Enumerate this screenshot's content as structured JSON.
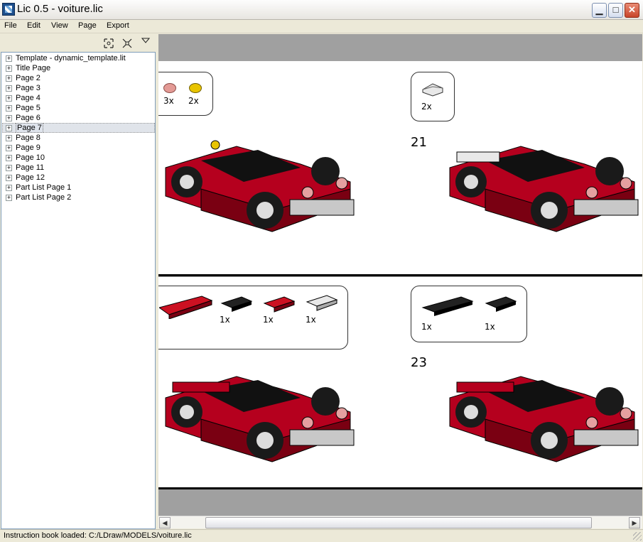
{
  "window": {
    "title": "Lic 0.5 - voiture.lic",
    "minimize_glyph": "▁",
    "maximize_glyph": "□",
    "close_glyph": "✕"
  },
  "menu": {
    "items": [
      "File",
      "Edit",
      "View",
      "Page",
      "Export"
    ]
  },
  "toolbar": {
    "icons": [
      "zoom-extents-icon",
      "zoom-fit-icon",
      "dropdown-arrow-icon"
    ]
  },
  "tree": {
    "items": [
      "Template - dynamic_template.lit",
      "Title Page",
      "Page 2",
      "Page 3",
      "Page 4",
      "Page 5",
      "Page 6",
      "Page 7",
      "Page 8",
      "Page 9",
      "Page 10",
      "Page 11",
      "Page 12",
      "Part List Page 1",
      "Part List Page 2"
    ],
    "selected": "Page 7",
    "expander": "+"
  },
  "canvas": {
    "top_page": {
      "pli_left": {
        "qtys": [
          "3x",
          "2x"
        ],
        "colors": [
          "#e39a95",
          "#e8c400"
        ]
      },
      "pli_right": {
        "qtys": [
          "2x"
        ],
        "colors": [
          "#e8e8e8"
        ]
      },
      "step_right": "21"
    },
    "bottom_page": {
      "pli_left": {
        "qtys": [
          "1x",
          "1x",
          "1x"
        ],
        "colors": [
          "#111111",
          "#cc1122",
          "#e8e8e8"
        ]
      },
      "pli_right": {
        "qtys": [
          "1x",
          "1x"
        ],
        "colors": [
          "#111111",
          "#111111"
        ]
      },
      "step_right": "23"
    },
    "model_colors": {
      "red": "#b5001e",
      "dark_red": "#7a0012",
      "black": "#111111",
      "gray": "#c8c8c8",
      "pink": "#e5a0a0",
      "tire": "#1a1a1a"
    }
  },
  "status": {
    "text": "Instruction book loaded: C:/LDraw/MODELS/voiture.lic"
  }
}
